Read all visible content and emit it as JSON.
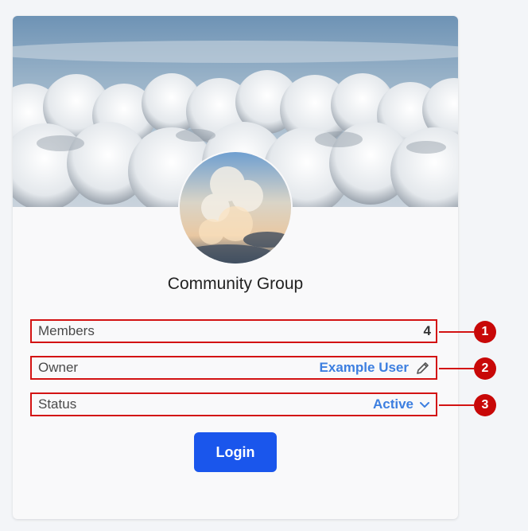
{
  "group": {
    "name": "Community Group"
  },
  "details": {
    "members": {
      "label": "Members",
      "value": "4"
    },
    "owner": {
      "label": "Owner",
      "value": "Example User"
    },
    "status": {
      "label": "Status",
      "value": "Active"
    }
  },
  "actions": {
    "login_label": "Login"
  },
  "annotations": [
    "1",
    "2",
    "3"
  ],
  "icons": {
    "owner_edit": "pencil-icon",
    "status_dropdown": "chevron-down-icon"
  },
  "colors": {
    "accent": "#1a56ec",
    "link": "#3d7fe0",
    "annotation": "#c80808"
  }
}
